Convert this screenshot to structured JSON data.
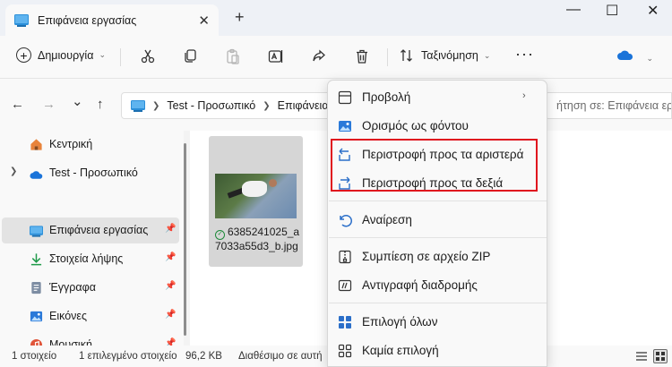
{
  "window": {
    "tab_title": "Επιφάνεια εργασίας",
    "close_glyph": "✕",
    "newtab_glyph": "+",
    "minimize_glyph": "—",
    "maximize_glyph": "☐",
    "close_window_glyph": "✕"
  },
  "toolbar": {
    "new_label": "Δημιουργία",
    "sort_label": "Ταξινόμηση",
    "more_label": "···",
    "icons": [
      "cut-icon",
      "copy-icon",
      "paste-icon",
      "rename-icon",
      "share-icon",
      "delete-icon",
      "sort-icon",
      "onedrive-icon"
    ]
  },
  "navigation": {
    "back": "←",
    "forward": "→",
    "down": "⌄",
    "up": "↑",
    "breadcrumb": [
      "Test - Προσωπικό",
      "Επιφάνεια εργ"
    ],
    "search_placeholder": "ήτηση σε: Επιφάνεια ερ..."
  },
  "sidebar": {
    "items": [
      {
        "label": "Κεντρική",
        "icon": "home-icon",
        "pinned": false
      },
      {
        "label": "Test - Προσωπικό",
        "icon": "onedrive-icon",
        "pinned": false,
        "expandable": true
      },
      {
        "label": "Επιφάνεια εργασίας",
        "icon": "desktop-icon",
        "pinned": true,
        "selected": true
      },
      {
        "label": "Στοιχεία λήψης",
        "icon": "download-icon",
        "pinned": true
      },
      {
        "label": "Έγγραφα",
        "icon": "documents-icon",
        "pinned": true
      },
      {
        "label": "Εικόνες",
        "icon": "pictures-icon",
        "pinned": true
      },
      {
        "label": "Μουσική",
        "icon": "music-icon",
        "pinned": true
      }
    ]
  },
  "content": {
    "files": [
      {
        "name": "6385241025_a7033a55d3_b.jpg",
        "sync_status": "synced-check-icon"
      }
    ]
  },
  "statusbar": {
    "count": "1 στοιχείο",
    "selected": "1 επιλεγμένο στοιχείο",
    "size": "96,2 KB",
    "availability": "Διαθέσιμο σε αυτή"
  },
  "context_menu": {
    "items": [
      {
        "label": "Προβολή",
        "icon": "view-icon",
        "submenu": true
      },
      {
        "label": "Ορισμός ως φόντου",
        "icon": "wallpaper-icon"
      },
      {
        "label": "Περιστροφή προς τα αριστερά",
        "icon": "rotate-left-icon"
      },
      {
        "label": "Περιστροφή προς τα δεξιά",
        "icon": "rotate-right-icon"
      },
      {
        "label": "Αναίρεση",
        "icon": "undo-icon"
      },
      {
        "label": "Συμπίεση σε αρχείο ZIP",
        "icon": "zip-icon"
      },
      {
        "label": "Αντιγραφή διαδρομής",
        "icon": "copy-path-icon"
      },
      {
        "label": "Επιλογή όλων",
        "icon": "select-all-icon"
      },
      {
        "label": "Καμία επιλογή",
        "icon": "select-none-icon"
      }
    ],
    "submenu_arrow": "›"
  },
  "colors": {
    "accent": "#0067c0",
    "highlight_border": "#e0141e",
    "synced": "#1e8a3a"
  }
}
